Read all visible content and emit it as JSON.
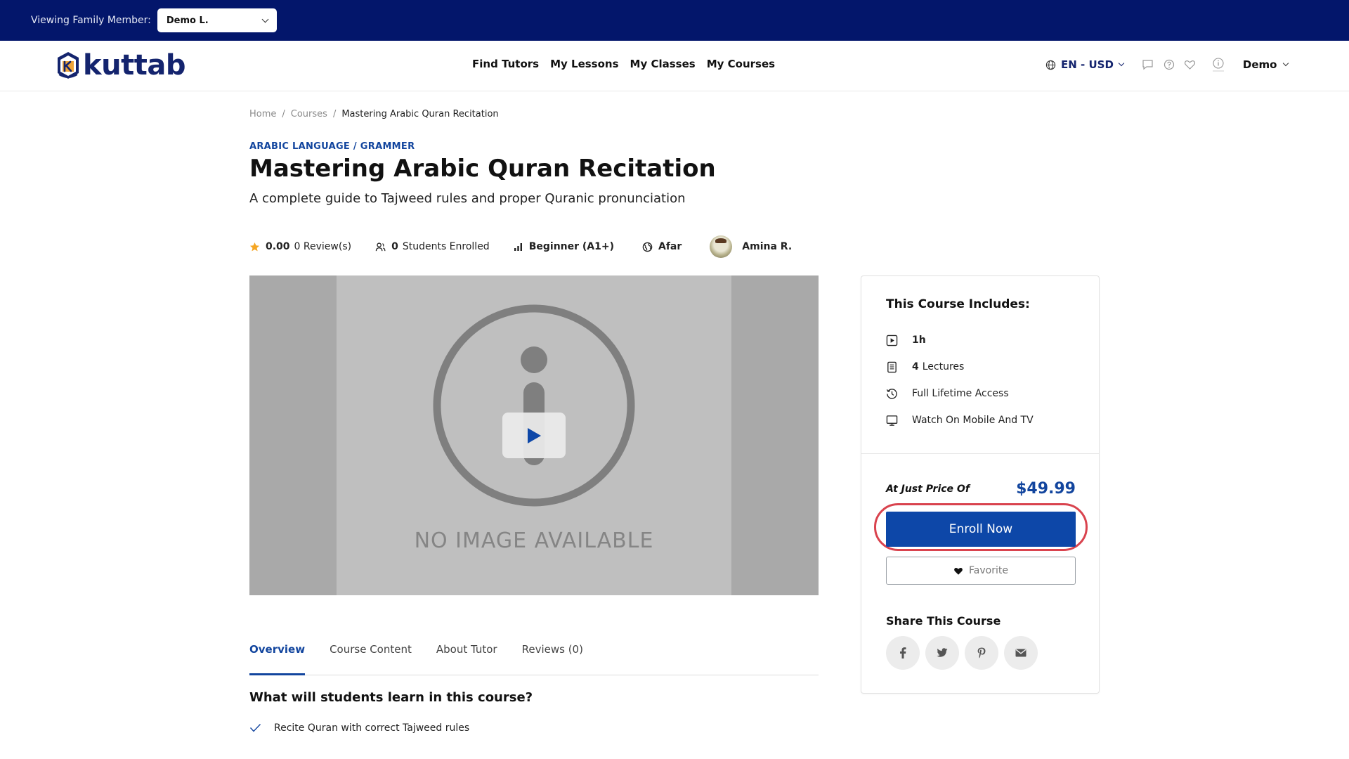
{
  "family_bar": {
    "label": "Viewing Family Member:",
    "selected": "Demo L."
  },
  "header": {
    "logo_text": "kuttab",
    "nav": [
      "Find Tutors",
      "My Lessons",
      "My Classes",
      "My Courses"
    ],
    "lang": "EN - USD",
    "user": "Demo"
  },
  "breadcrumb": {
    "home": "Home",
    "courses": "Courses",
    "current": "Mastering Arabic Quran Recitation",
    "sep": "/"
  },
  "course": {
    "category": "ARABIC LANGUAGE / GRAMMER",
    "title": "Mastering Arabic Quran Recitation",
    "subtitle": "A complete guide to Tajweed rules and proper Quranic pronunciation",
    "rating": "0.00",
    "reviews": "0 Review(s)",
    "students_count": "0",
    "students_label": "Students Enrolled",
    "level": "Beginner (A1+)",
    "language": "Afar",
    "tutor": "Amina R."
  },
  "video": {
    "placeholder_text": "NO IMAGE AVAILABLE"
  },
  "tabs": [
    "Overview",
    "Course Content",
    "About Tutor",
    "Reviews (0)"
  ],
  "learn": {
    "title": "What will students learn in this course?",
    "items": [
      "Recite Quran with correct Tajweed rules"
    ]
  },
  "sidebar": {
    "title": "This Course Includes:",
    "duration": "1h",
    "lectures_count": "4",
    "lectures_label": "Lectures",
    "access": "Full Lifetime Access",
    "devices": "Watch On Mobile And TV",
    "price_label": "At Just Price Of",
    "price": "$49.99",
    "enroll": "Enroll Now",
    "favorite": "Favorite",
    "share_title": "Share This Course"
  },
  "colors": {
    "topbar": "#03166b",
    "brand": "#14246e",
    "accent": "#12459e",
    "enroll": "#0d47a8",
    "highlight_ring": "#d9434e"
  },
  "icons": [
    "chevron-down-icon",
    "globe-icon",
    "chat-icon",
    "help-icon",
    "heart-icon",
    "info-icon",
    "star-icon",
    "users-icon",
    "level-bars-icon",
    "language-globe-icon",
    "play-icon",
    "video-icon",
    "document-icon",
    "history-icon",
    "monitor-icon",
    "check-icon",
    "facebook-icon",
    "twitter-icon",
    "pinterest-icon",
    "email-icon"
  ]
}
